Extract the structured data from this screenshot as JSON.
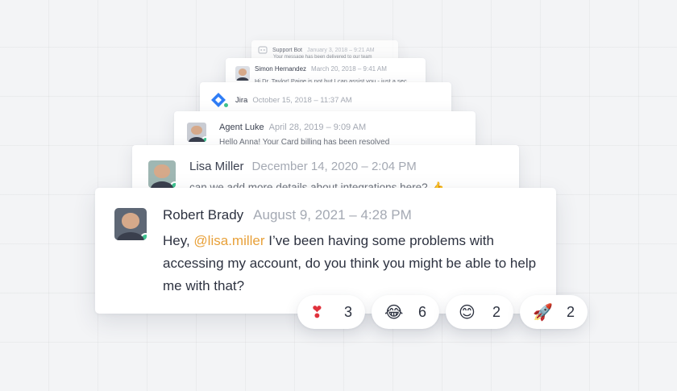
{
  "messages": [
    {
      "name": "Support Bot",
      "time": "January 3, 2018 – 9:21 AM",
      "text": "Your message has been delivered to our team"
    },
    {
      "name": "Simon Hernandez",
      "time": "March 20, 2018 – 9:41 AM",
      "text": "Hi Dr. Taylor! Paige is not but I can assist you - just a sec"
    },
    {
      "name": "Jira",
      "time": "October 15, 2018 – 11:37 AM"
    },
    {
      "name": "Agent Luke",
      "time": "April 28, 2019 – 9:09 AM",
      "text": "Hello Anna! Your Card billing has been resolved"
    },
    {
      "name": "Lisa Miller",
      "time": "December 14, 2020 – 2:04 PM",
      "text": "can we add more details about integrations here? 👍"
    },
    {
      "name": "Robert Brady",
      "time": "August 9, 2021 – 4:28 PM",
      "text_before": "Hey, ",
      "mention": "@lisa.miller",
      "text_after": " I’ve been having some problems with accessing my account, do you think you might be able to help me with that?"
    }
  ],
  "reactions": [
    {
      "emoji": "❣",
      "count": "3",
      "icon": "heart-exclamation-icon",
      "color": "#e0323c"
    },
    {
      "emoji": "😂",
      "count": "6",
      "icon": "laughing-face-icon"
    },
    {
      "emoji": "😊",
      "count": "2",
      "icon": "smiling-face-icon"
    },
    {
      "emoji": "🚀",
      "count": "2",
      "icon": "rocket-icon"
    }
  ],
  "colors": {
    "mention": "#e8a13a",
    "online": "#3ec28f",
    "jira": "#2f7df6"
  }
}
